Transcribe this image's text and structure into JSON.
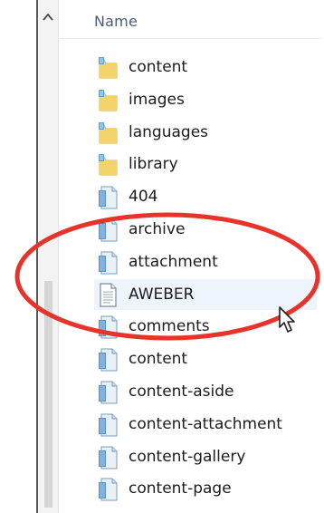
{
  "explorer": {
    "column_header": "Name",
    "items": [
      {
        "name": "content",
        "type": "folder",
        "icon": "folder-icon"
      },
      {
        "name": "images",
        "type": "folder",
        "icon": "folder-icon"
      },
      {
        "name": "languages",
        "type": "folder",
        "icon": "folder-icon"
      },
      {
        "name": "library",
        "type": "folder",
        "icon": "folder-icon"
      },
      {
        "name": "404",
        "type": "file",
        "icon": "php-file-icon"
      },
      {
        "name": "archive",
        "type": "file",
        "icon": "php-file-icon"
      },
      {
        "name": "attachment",
        "type": "file",
        "icon": "php-file-icon"
      },
      {
        "name": "AWEBER",
        "type": "file",
        "icon": "text-file-icon"
      },
      {
        "name": "comments",
        "type": "file",
        "icon": "php-file-icon"
      },
      {
        "name": "content",
        "type": "file",
        "icon": "php-file-icon"
      },
      {
        "name": "content-aside",
        "type": "file",
        "icon": "php-file-icon"
      },
      {
        "name": "content-attachment",
        "type": "file",
        "icon": "php-file-icon"
      },
      {
        "name": "content-gallery",
        "type": "file",
        "icon": "php-file-icon"
      },
      {
        "name": "content-page",
        "type": "file",
        "icon": "php-file-icon"
      }
    ]
  },
  "annotation": {
    "highlight_color": "#e8332a",
    "highlighted_items": [
      "archive",
      "attachment",
      "AWEBER",
      "comments"
    ]
  },
  "colors": {
    "header_text": "#4b5c76",
    "folder_yellow": "#f5d36b",
    "file_blue": "#5b93c9",
    "selection": "#eef4fb"
  }
}
